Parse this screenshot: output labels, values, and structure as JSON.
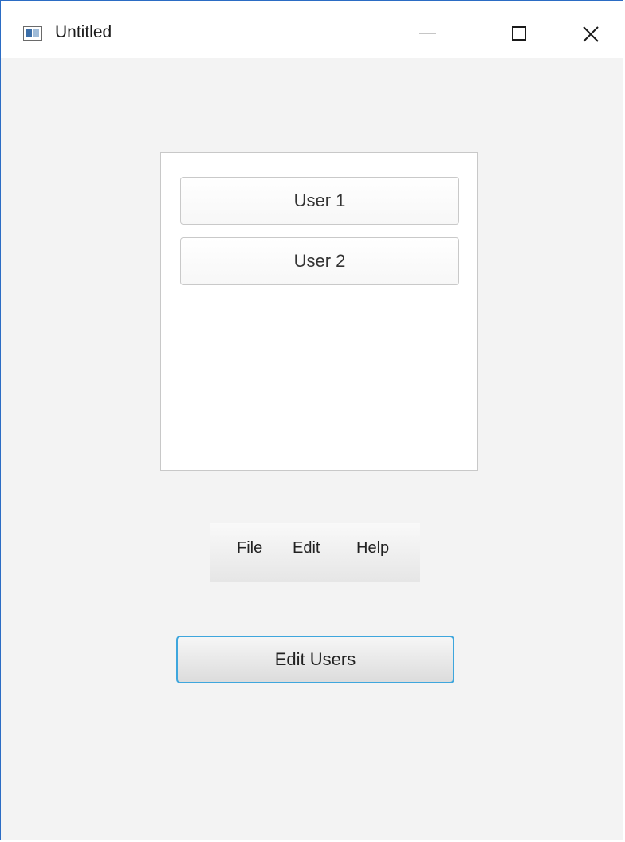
{
  "window": {
    "title": "Untitled"
  },
  "controls": {
    "minimize": "minimize-icon",
    "maximize": "maximize-icon",
    "close": "close-icon"
  },
  "user_list": {
    "items": [
      {
        "label": "User 1"
      },
      {
        "label": "User 2"
      }
    ]
  },
  "menubar": {
    "items": [
      {
        "label": "File"
      },
      {
        "label": "Edit"
      },
      {
        "label": "Help"
      }
    ]
  },
  "actions": {
    "edit_users_label": "Edit Users"
  },
  "colors": {
    "window_border": "#2b6cc4",
    "focus_ring": "#3ea6dd",
    "background": "#f3f3f3"
  }
}
